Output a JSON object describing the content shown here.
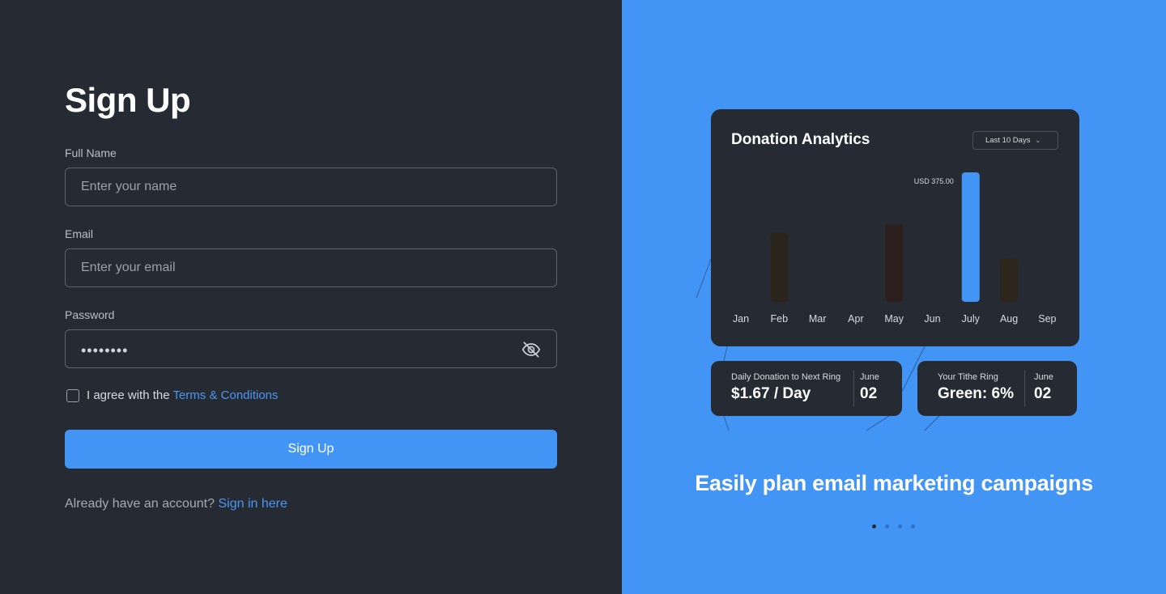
{
  "signup": {
    "title": "Sign Up",
    "full_name_label": "Full Name",
    "full_name_placeholder": "Enter your name",
    "email_label": "Email",
    "email_placeholder": "Enter your email",
    "password_label": "Password",
    "password_value": "••••••••",
    "agree_text": "I agree with the ",
    "terms_link": "Terms & Conditions",
    "button_label": "Sign Up",
    "already_text": "Already have an account? ",
    "signin_link": "Sign in here"
  },
  "analytics": {
    "title": "Donation Analytics",
    "range_label": "Last 10 Days",
    "range_icon": "chevron-down-icon"
  },
  "chart_data": {
    "type": "bar",
    "categories": [
      "Jan",
      "Feb",
      "Mar",
      "Apr",
      "May",
      "Jun",
      "July",
      "Aug",
      "Sep"
    ],
    "values": [
      0,
      200,
      0,
      0,
      225,
      0,
      375,
      125,
      0
    ],
    "highlight_index": 6,
    "annotation": "USD 375.00",
    "ylim": [
      0,
      375
    ],
    "grid": false,
    "colors": {
      "highlight": "#4294f5",
      "muted": [
        "#2b241c",
        "#2e1f1f",
        "#2c261c"
      ]
    }
  },
  "stats": [
    {
      "label": "Daily Donation to Next Ring",
      "value": "$1.67 / Day",
      "month": "June",
      "day": "02"
    },
    {
      "label": "Your Tithe Ring",
      "value": "Green: 6%",
      "month": "June",
      "day": "02"
    }
  ],
  "carousel": {
    "tagline": "Easily plan email marketing campaigns",
    "slide_count": 4,
    "active_slide": 0
  },
  "colors": {
    "panel_dark": "#262b33",
    "accent": "#4294f5",
    "link": "#4a96f2"
  }
}
